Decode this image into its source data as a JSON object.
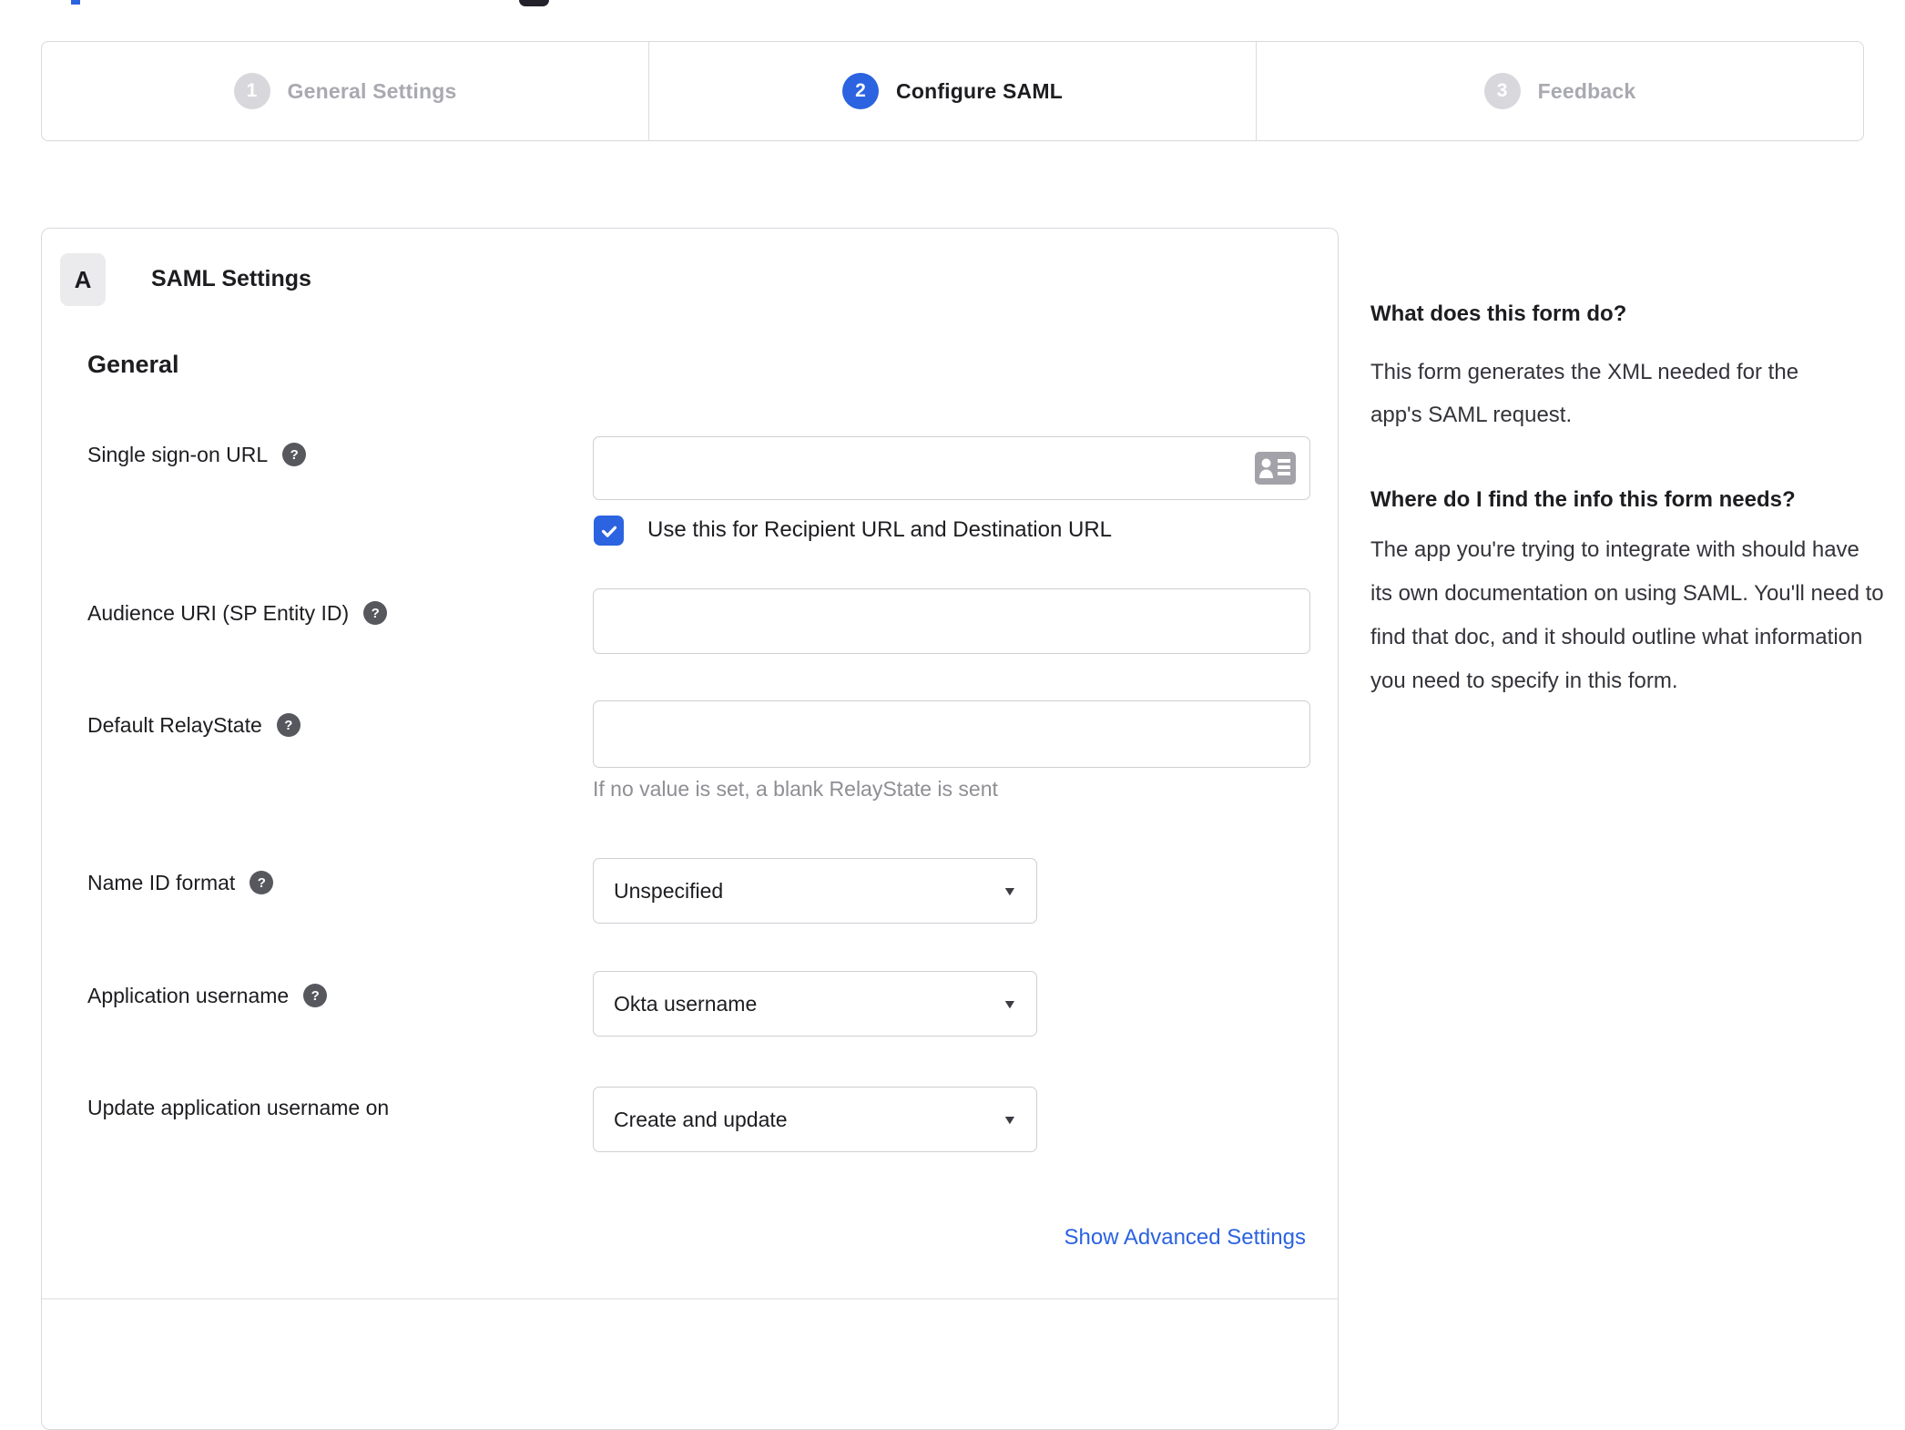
{
  "colors": {
    "accent_blue": "#2b63e0",
    "inactive_step_gray": "#d8d8dc",
    "muted_label_gray": "#a9a9b0",
    "border_gray": "#d9d9de",
    "helper_text_gray": "#8e8e94",
    "help_icon_gray": "#57575e"
  },
  "icons": {
    "help_glyph": "?",
    "select_caret": "▼",
    "checkbox_glyph": "checkmark",
    "sso_input_icon": "contact-card"
  },
  "stepper": {
    "steps": [
      {
        "number": "1",
        "label": "General Settings"
      },
      {
        "number": "2",
        "label": "Configure SAML"
      },
      {
        "number": "3",
        "label": "Feedback"
      }
    ]
  },
  "panel": {
    "badge": "A",
    "title": "SAML Settings",
    "section_heading": "General",
    "fields": {
      "sso": {
        "label": "Single sign-on URL",
        "value": "",
        "checkbox_label": "Use this for Recipient URL and Destination URL",
        "checkbox_checked": true
      },
      "audience": {
        "label": "Audience URI (SP Entity ID)",
        "value": ""
      },
      "relay": {
        "label": "Default RelayState",
        "value": "",
        "helper_text": "If no value is set, a blank RelayState is sent"
      },
      "name_id": {
        "label": "Name ID format",
        "value": "Unspecified"
      },
      "app_username": {
        "label": "Application username",
        "value": "Okta username"
      },
      "update_username": {
        "label": "Update application username on",
        "value": "Create and update"
      }
    },
    "advanced_link": "Show Advanced Settings"
  },
  "sidebar": {
    "blocks": [
      {
        "heading": "What does this form do?",
        "body": "This form generates the XML needed for the app's SAML request."
      },
      {
        "heading": "Where do I find the info this form needs?",
        "body": "The app you're trying to integrate with should have its own documentation on using SAML. You'll need to find that doc, and it should outline what information you need to specify in this form."
      }
    ]
  }
}
